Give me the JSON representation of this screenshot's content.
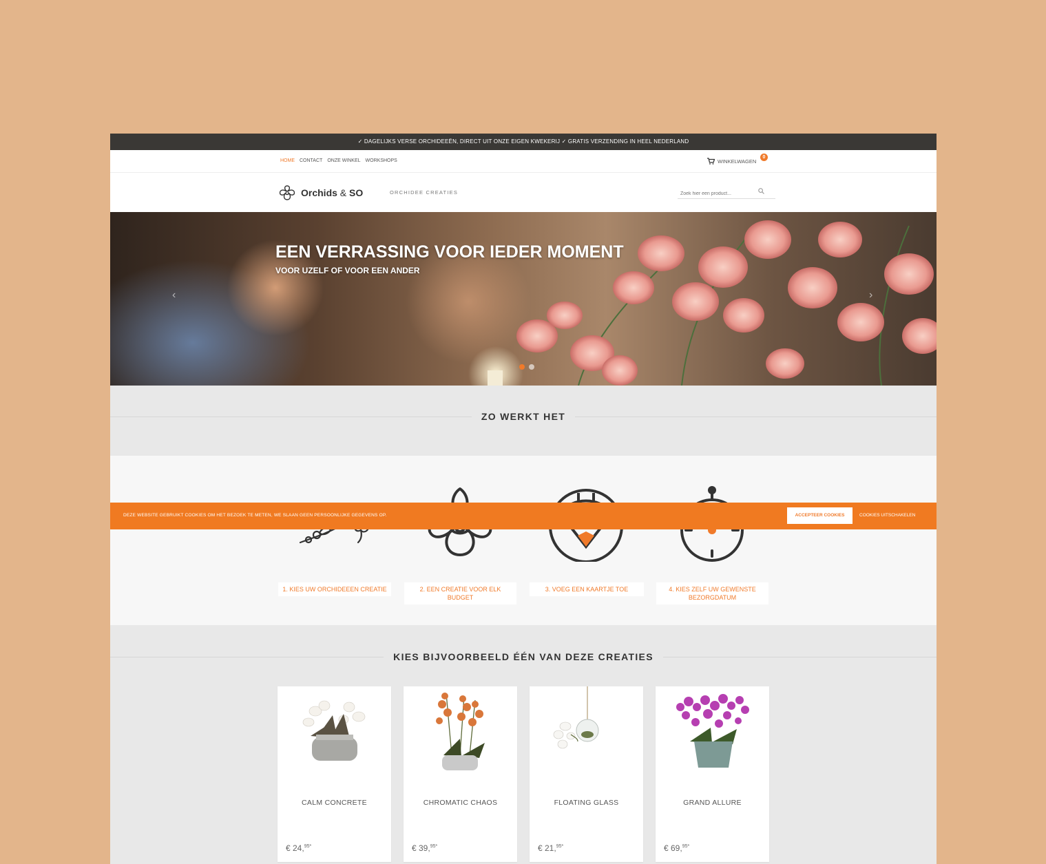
{
  "topbar": {
    "text": "✓ DAGELIJKS VERSE ORCHIDEEËN, DIRECT UIT ONZE EIGEN KWEKERIJ ✓ GRATIS VERZENDING IN HEEL NEDERLAND"
  },
  "nav": {
    "items": [
      {
        "label": "HOME",
        "active": true
      },
      {
        "label": "CONTACT",
        "active": false
      },
      {
        "label": "ONZE WINKEL",
        "active": false
      },
      {
        "label": "WORKSHOPS",
        "active": false
      }
    ],
    "cart_label": "WINKELWAGEN",
    "cart_count": "0",
    "cart_icon": "cart-icon"
  },
  "header": {
    "logo_text": "Orchids",
    "logo_amp": "&",
    "logo_text2": "SO",
    "logo_icon": "orchid-logo-icon",
    "tagline": "ORCHIDEE CREATIES",
    "search_placeholder": "Zoek hier een product...",
    "search_icon": "search-icon"
  },
  "hero": {
    "title": "EEN VERRASSING VOOR IEDER MOMENT",
    "subtitle": "VOOR UZELF OF VOOR EEN ANDER",
    "prev_arrow": "‹",
    "next_arrow": "›"
  },
  "how": {
    "heading": "ZO WERKT HET",
    "steps": [
      {
        "label": "1. KIES UW ORCHIDEEEN CREATIE",
        "icon": "orchid-branches-icon"
      },
      {
        "label": "2. EEN CREATIE VOOR ELK BUDGET",
        "icon": "orchid-flower-icon"
      },
      {
        "label": "3. VOEG EEN KAARTJE TOE",
        "icon": "card-pin-icon"
      },
      {
        "label": "4. KIES ZELF UW GEWENSTE BEZORGDATUM",
        "icon": "stopwatch-icon"
      }
    ]
  },
  "cookie": {
    "text": "DEZE WEBSITE GEBRUIKT COOKIES OM HET BEZOEK TE METEN, WE SLAAN GEEN PERSOONLIJKE GEGEVENS OP.",
    "accept": "ACCEPTEER COOKIES",
    "decline": "COOKIES UITSCHAKELEN"
  },
  "products": {
    "heading": "KIES BIJVOORBEELD ÉÉN VAN DEZE CREATIES",
    "items": [
      {
        "name": "CALM CONCRETE",
        "price_main": "€ 24,",
        "price_cents": "95*"
      },
      {
        "name": "CHROMATIC CHAOS",
        "price_main": "€ 39,",
        "price_cents": "95*"
      },
      {
        "name": "FLOATING GLASS",
        "price_main": "€ 21,",
        "price_cents": "95*"
      },
      {
        "name": "GRAND ALLURE",
        "price_main": "€ 69,",
        "price_cents": "95*"
      }
    ]
  },
  "colors": {
    "accent": "#f07a2a",
    "topbar": "#3a3835",
    "page_bg": "#e3b58b"
  }
}
